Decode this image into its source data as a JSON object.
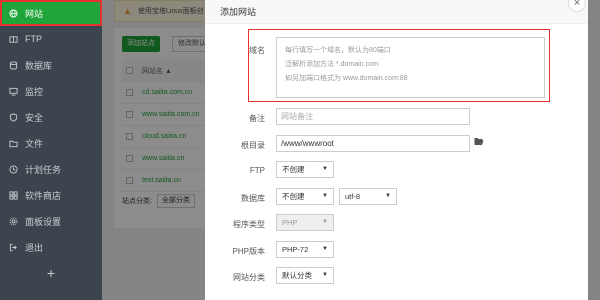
{
  "sidebar": {
    "items": [
      {
        "label": "网站",
        "icon": "globe-icon"
      },
      {
        "label": "FTP",
        "icon": "ftp-icon"
      },
      {
        "label": "数据库",
        "icon": "database-icon"
      },
      {
        "label": "监控",
        "icon": "monitor-icon"
      },
      {
        "label": "安全",
        "icon": "shield-icon"
      },
      {
        "label": "文件",
        "icon": "folder-icon"
      },
      {
        "label": "计划任务",
        "icon": "clock-icon"
      },
      {
        "label": "软件商店",
        "icon": "store-icon"
      },
      {
        "label": "面板设置",
        "icon": "gear-icon"
      },
      {
        "label": "退出",
        "icon": "logout-icon"
      }
    ],
    "add_label": "+"
  },
  "main": {
    "notice": "使用宝塔Linux面板创",
    "add_site_button": "添加站点",
    "modify_default_button": "修改默认页",
    "table_header": "网站名 ▲",
    "sites": [
      "cd.saiita.com.cn",
      "www.saiita.com.cn",
      "cloud.saiita.cn",
      "www.saiita.cn",
      "test.saiita.cn"
    ],
    "site_category_label": "站点分类:",
    "site_category_value": "全部分类"
  },
  "modal": {
    "title": "添加网站",
    "close": "×",
    "domain_label": "域名",
    "domain_placeholder_lines": [
      "每行填写一个域名，默认为80端口",
      "泛解析添加方法 *.domain.com",
      "如另加端口格式为 www.domain.com:88"
    ],
    "remark_label": "备注",
    "remark_placeholder": "网站备注",
    "root_label": "根目录",
    "root_value": "/www/wwwroot",
    "ftp_label": "FTP",
    "ftp_value": "不创建",
    "db_label": "数据库",
    "db_value": "不创建",
    "db_charset": "utf-8",
    "program_type_label": "程序类型",
    "program_type_value": "PHP",
    "php_version_label": "PHP版本",
    "php_version_value": "PHP-72",
    "site_category_label": "网站分类",
    "site_category_value": "默认分类"
  }
}
